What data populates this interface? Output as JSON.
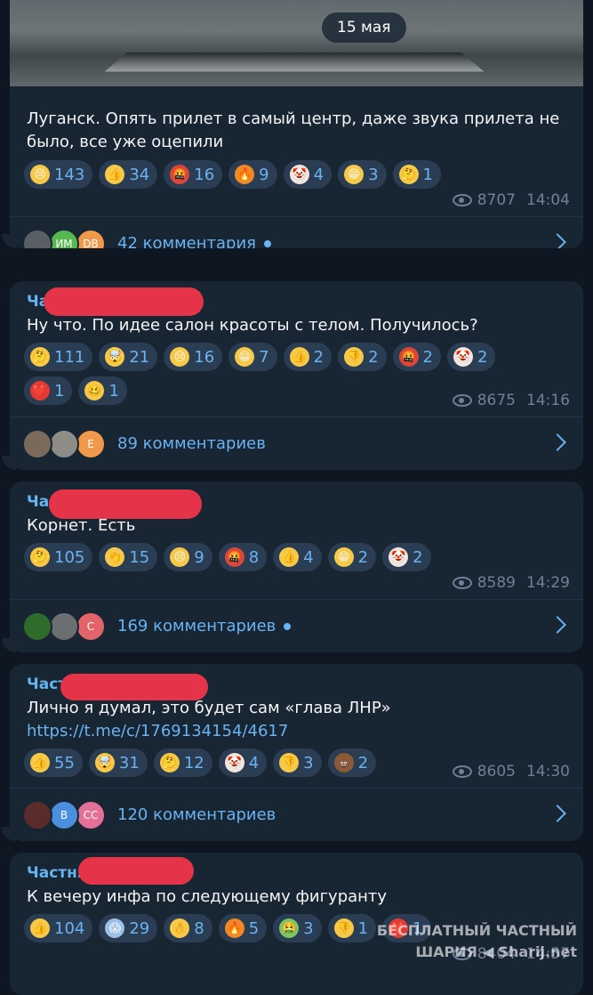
{
  "date_pill": "15 мая",
  "posts": [
    {
      "author": "",
      "text": "Луганск. Опять прилет в самый центр, даже звука прилета не было, все уже оцепили",
      "link": "",
      "reactions": [
        {
          "emoji": "😢",
          "count": "143"
        },
        {
          "emoji": "👍",
          "count": "34"
        },
        {
          "emoji": "🤬",
          "count": "16"
        },
        {
          "emoji": "🔥",
          "count": "9"
        },
        {
          "emoji": "🤡",
          "count": "4"
        },
        {
          "emoji": "😁",
          "count": "3"
        },
        {
          "emoji": "🤔",
          "count": "1"
        }
      ],
      "views": "8707",
      "time": "14:04",
      "comments": "42 комментария",
      "unread": true,
      "avatars": [
        {
          "label": "",
          "color": "#5a5f66"
        },
        {
          "label": "ИМ",
          "color": "#58b84f"
        },
        {
          "label": "DB",
          "color": "#f0994a"
        }
      ]
    },
    {
      "author": "Ча…РИЯ",
      "text": "Ну что. По идее салон красоты с телом. Получилось?",
      "link": "",
      "reactions": [
        {
          "emoji": "🤔",
          "count": "111"
        },
        {
          "emoji": "🤯",
          "count": "21"
        },
        {
          "emoji": "😢",
          "count": "16"
        },
        {
          "emoji": "😁",
          "count": "7"
        },
        {
          "emoji": "👍",
          "count": "2"
        },
        {
          "emoji": "👎",
          "count": "2"
        },
        {
          "emoji": "🤬",
          "count": "2"
        },
        {
          "emoji": "🤡",
          "count": "2"
        },
        {
          "emoji": "❤️",
          "count": "1"
        },
        {
          "emoji": "🥴",
          "count": "1"
        }
      ],
      "views": "8675",
      "time": "14:16",
      "comments": "89 комментариев",
      "unread": false,
      "avatars": [
        {
          "label": "",
          "color": "#7a6a5c"
        },
        {
          "label": "",
          "color": "#8e8c86"
        },
        {
          "label": "E",
          "color": "#f0994a"
        }
      ]
    },
    {
      "author": "Ча…РИЯ",
      "text": "Корнет. Есть",
      "link": "",
      "reactions": [
        {
          "emoji": "🤔",
          "count": "105"
        },
        {
          "emoji": "👏",
          "count": "15"
        },
        {
          "emoji": "😢",
          "count": "9"
        },
        {
          "emoji": "🤬",
          "count": "8"
        },
        {
          "emoji": "👍",
          "count": "4"
        },
        {
          "emoji": "😁",
          "count": "2"
        },
        {
          "emoji": "🤡",
          "count": "2"
        }
      ],
      "views": "8589",
      "time": "14:29",
      "comments": "169 комментариев",
      "unread": true,
      "avatars": [
        {
          "label": "",
          "color": "#2f6b2a"
        },
        {
          "label": "",
          "color": "#6b6f72"
        },
        {
          "label": "C",
          "color": "#e2636a"
        }
      ]
    },
    {
      "author": "Част…РИЯ",
      "text": "Лично я думал, это будет сам «глава ЛНР»",
      "link": "https://t.me/c/1769134154/4617",
      "reactions": [
        {
          "emoji": "👍",
          "count": "55"
        },
        {
          "emoji": "🤯",
          "count": "31"
        },
        {
          "emoji": "🤔",
          "count": "12"
        },
        {
          "emoji": "🤡",
          "count": "4"
        },
        {
          "emoji": "👎",
          "count": "3"
        },
        {
          "emoji": "💩",
          "count": "2"
        }
      ],
      "views": "8605",
      "time": "14:30",
      "comments": "120 комментариев",
      "unread": false,
      "avatars": [
        {
          "label": "",
          "color": "#5a2b2b"
        },
        {
          "label": "B",
          "color": "#4a8fe0"
        },
        {
          "label": "CC",
          "color": "#e46f97"
        }
      ]
    },
    {
      "author": "Частн…РИЯ",
      "text": "К вечеру инфа по следующему фигуранту",
      "link": "",
      "reactions": [
        {
          "emoji": "👍",
          "count": "104"
        },
        {
          "emoji": "😱",
          "count": "29"
        },
        {
          "emoji": "👌",
          "count": "8"
        },
        {
          "emoji": "🔥",
          "count": "5"
        },
        {
          "emoji": "🤮",
          "count": "3"
        },
        {
          "emoji": "👎",
          "count": "1"
        },
        {
          "emoji": "❤️",
          "count": "1"
        }
      ],
      "views": "8404",
      "time": "14:57",
      "comments": "",
      "unread": false,
      "avatars": []
    }
  ],
  "watermark": {
    "line1": "БЕСПЛАТНЫЙ ЧАСТНЫЙ",
    "line2": "ШАРИЯ",
    "line3": "Sharij.net"
  },
  "colors": {
    "background": "#0e1621",
    "bubble": "#182533",
    "reaction_bg": "#2b3d52",
    "accent": "#6ab3f3",
    "redaction": "#e5334a"
  },
  "icons": {
    "views": "eye-icon",
    "open_comments": "chevron-right-icon"
  }
}
